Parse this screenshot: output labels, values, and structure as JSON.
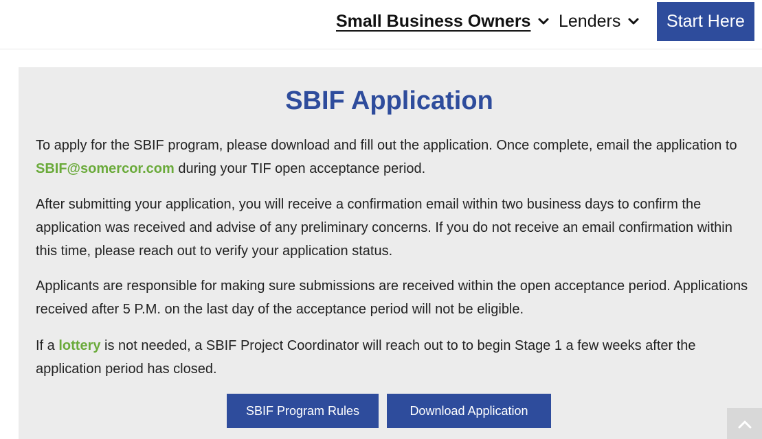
{
  "nav": {
    "small_business_owners": "Small Business Owners",
    "lenders": "Lenders",
    "start_here": "Start Here"
  },
  "section": {
    "title": "SBIF Application",
    "p1_before": "To apply for the SBIF program, please download and fill out the application. Once complete, email the application to ",
    "p1_link": "SBIF@somercor.com",
    "p1_after": " during your TIF open acceptance period.",
    "p2": "After submitting your application, you will receive a confirmation email within two business days to confirm the application was received and advise of any preliminary concerns. If you do not receive an email confirmation within this time, please reach out to verify your application status.",
    "p3": "Applicants are responsible for making sure submissions are received within the open acceptance period. Applications received after 5 P.M. on the last day of the acceptance period will not be eligible.",
    "p4_before": "If a ",
    "p4_link": "lottery",
    "p4_after": " is not needed, a SBIF Project Coordinator will reach out to to begin Stage 1 a few weeks after the application period has closed."
  },
  "buttons": {
    "program_rules": "SBIF Program Rules",
    "download_application": "Download Application"
  },
  "icons": {
    "dropdown": "chevron-down-icon",
    "scroll_top": "chevron-up-icon"
  },
  "colors": {
    "brand_blue": "#2e4c9c",
    "link_green": "#6aaa3a",
    "panel_bg": "#ececec"
  }
}
